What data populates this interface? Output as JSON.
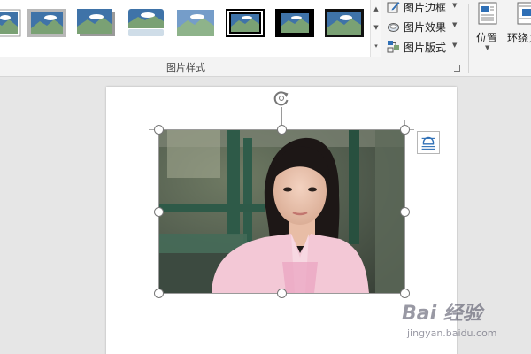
{
  "ribbon": {
    "picture_styles_group_label": "图片样式",
    "commands": {
      "picture_border": "图片边框",
      "picture_effects": "图片效果",
      "picture_layout": "图片版式"
    },
    "arrange": {
      "position": "位置",
      "wrap_text": "环绕文"
    },
    "gallery_styles": [
      "simple-frame-white",
      "beveled-matte-white",
      "drop-shadow-rectangle",
      "reflected-rounded-rectangle",
      "soft-edge-rectangle",
      "double-frame-black",
      "thick-matte-black",
      "simple-frame-black"
    ]
  },
  "watermark": {
    "brand": "Bai 经验",
    "url": "jingyan.baidu.com"
  },
  "colors": {
    "ribbon_bg": "#f3f3f3",
    "gallery_bg": "#ffffff",
    "workspace_bg": "#e6e6e6",
    "selection_line": "#9a9a9a",
    "icon_blue": "#2e6fb6"
  }
}
